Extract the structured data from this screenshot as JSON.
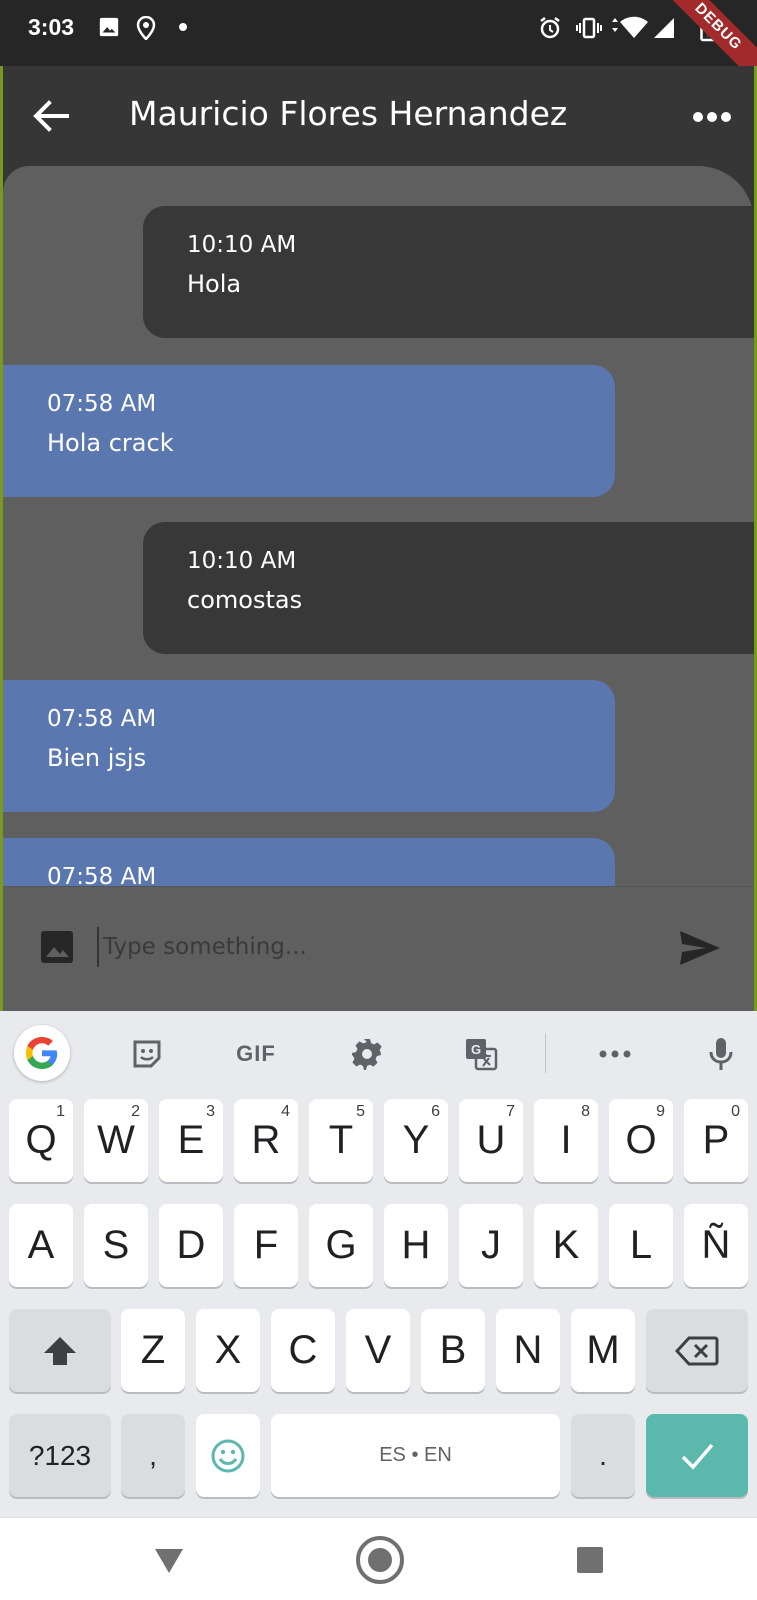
{
  "status_bar": {
    "time": "3:03",
    "debug_label": "DEBUG"
  },
  "app_bar": {
    "title": "Mauricio Flores Hernandez"
  },
  "messages": [
    {
      "time": "10:10 AM",
      "text": "Hola",
      "side": "sent"
    },
    {
      "time": "07:58 AM",
      "text": "Hola crack",
      "side": "received"
    },
    {
      "time": "10:10 AM",
      "text": "comostas",
      "side": "sent"
    },
    {
      "time": "07:58 AM",
      "text": "Bien jsjs",
      "side": "received"
    },
    {
      "time": "07:58 AM",
      "text": "",
      "side": "received"
    }
  ],
  "composer": {
    "placeholder": "Type something..."
  },
  "keyboard": {
    "toolbar": {
      "gif_label": "GIF"
    },
    "row1": [
      {
        "label": "Q",
        "hint": "1"
      },
      {
        "label": "W",
        "hint": "2"
      },
      {
        "label": "E",
        "hint": "3"
      },
      {
        "label": "R",
        "hint": "4"
      },
      {
        "label": "T",
        "hint": "5"
      },
      {
        "label": "Y",
        "hint": "6"
      },
      {
        "label": "U",
        "hint": "7"
      },
      {
        "label": "I",
        "hint": "8"
      },
      {
        "label": "O",
        "hint": "9"
      },
      {
        "label": "P",
        "hint": "0"
      }
    ],
    "row2": [
      "A",
      "S",
      "D",
      "F",
      "G",
      "H",
      "J",
      "K",
      "L",
      "Ñ"
    ],
    "row3": [
      "Z",
      "X",
      "C",
      "V",
      "B",
      "N",
      "M"
    ],
    "symbols_label": "?123",
    "comma_label": ",",
    "space_label": "ES • EN",
    "period_label": "."
  },
  "colors": {
    "sent_bubble": "#383838",
    "received_bubble": "#5a77b0",
    "chat_background": "#5f5f5f",
    "app_bar": "#363636",
    "enter_key": "#5bb8ac"
  }
}
